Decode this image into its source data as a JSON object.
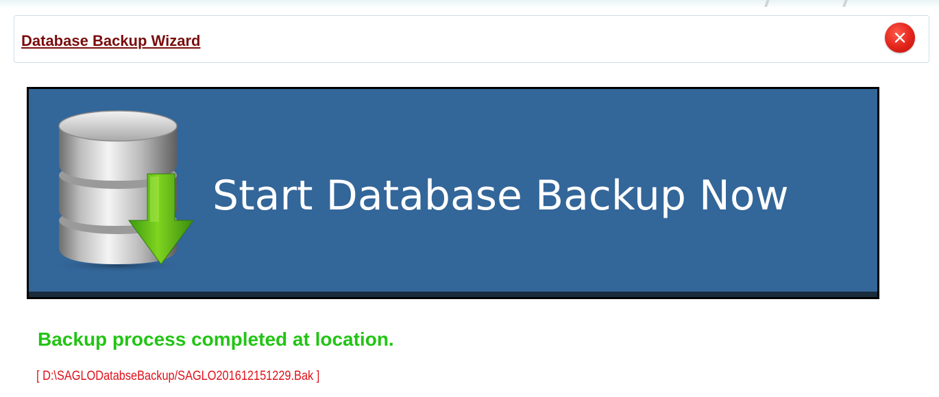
{
  "window": {
    "title": "Database Backup Wizard"
  },
  "banner": {
    "label": "Start Database Backup Now",
    "background_color": "#336699",
    "icon": "database-download-icon"
  },
  "status": {
    "message": "Backup process completed at location.",
    "path": "[ D:\\SAGLODatabseBackup/SAGLO201612151229.Bak ]",
    "message_color": "#22c414",
    "path_color": "#e0101a"
  },
  "icons": {
    "close": "close-icon",
    "database": "database-icon",
    "download_arrow": "download-arrow-icon"
  }
}
